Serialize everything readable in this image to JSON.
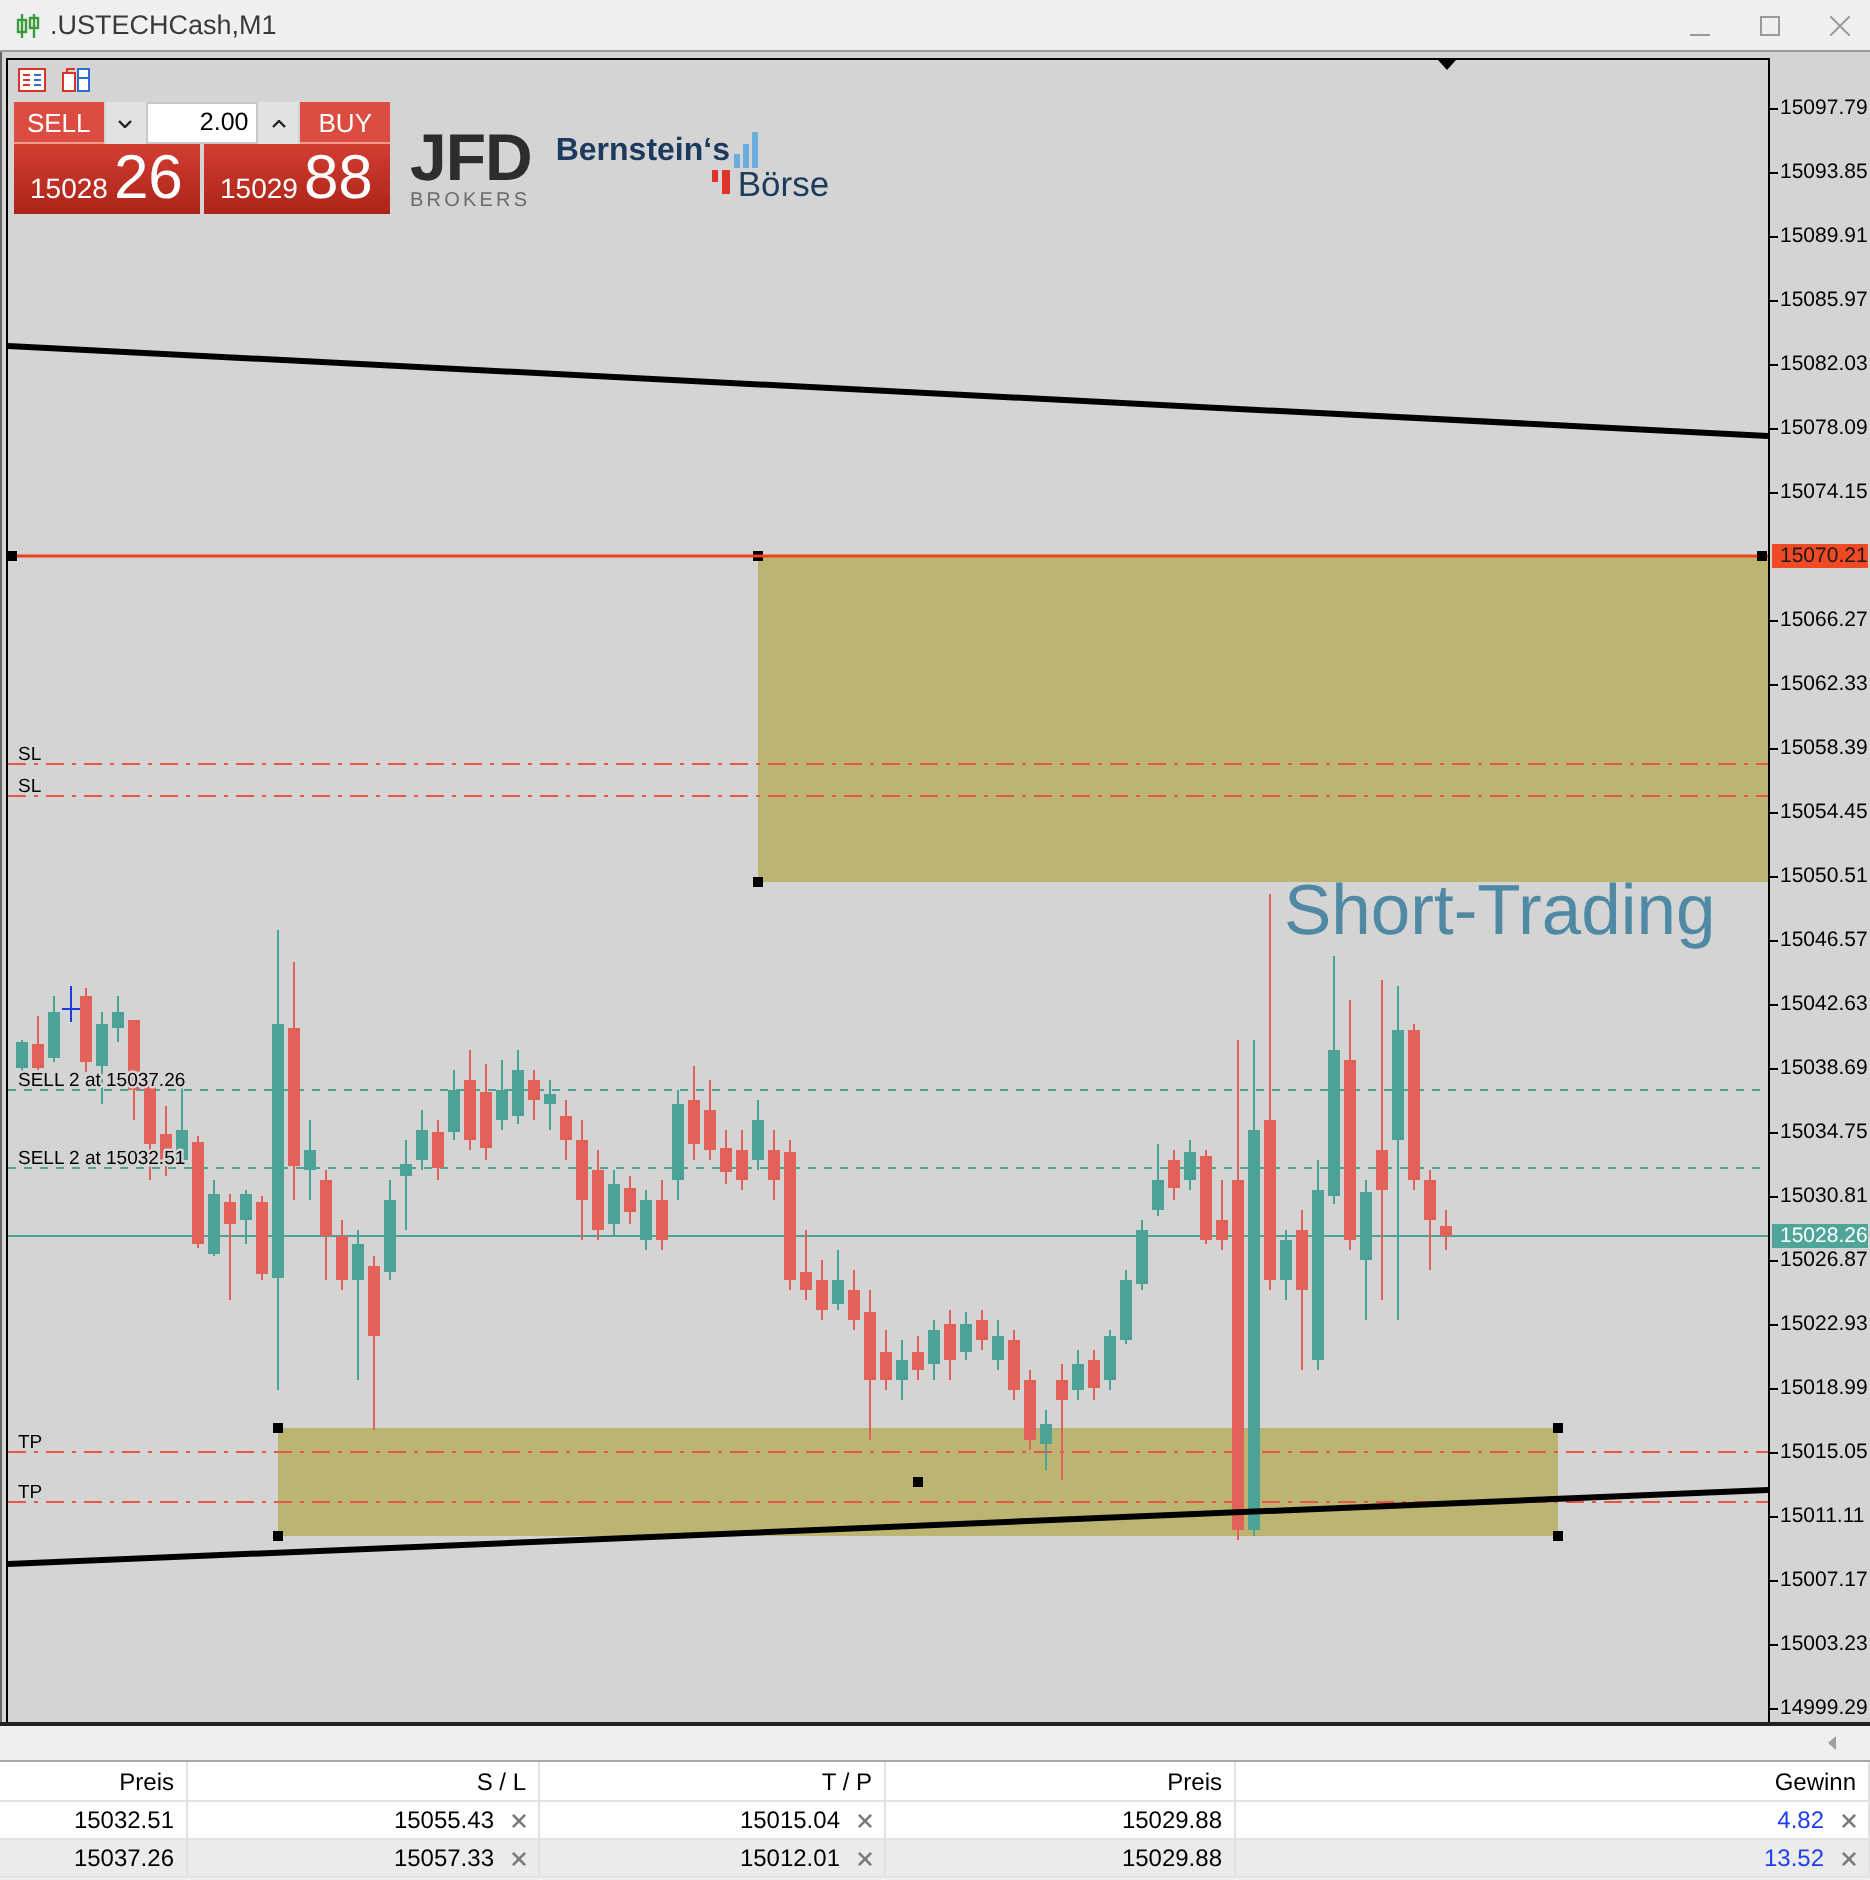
{
  "window": {
    "title": ".USTECHCash,M1"
  },
  "trade_panel": {
    "sell": {
      "label": "SELL",
      "price_lead": "15028",
      "price_pips": "26"
    },
    "buy": {
      "label": "BUY",
      "price_lead": "15029",
      "price_pips": "88"
    },
    "lot": {
      "value": "2.00"
    }
  },
  "logos": {
    "jfd": {
      "wordmark": "JFD",
      "tagline": "BROKERS"
    },
    "bernstein": {
      "line_1": "Bernstein‘s",
      "line_2": "Börse"
    }
  },
  "chart": {
    "caption": "Short-Trading",
    "order_lines": [
      {
        "kind": "sl",
        "label": "SL"
      },
      {
        "kind": "sl",
        "label": "SL"
      },
      {
        "kind": "entry",
        "label": "SELL 2 at 15037.26"
      },
      {
        "kind": "entry",
        "label": "SELL 2 at 15032.51"
      },
      {
        "kind": "tp",
        "label": "TP"
      },
      {
        "kind": "tp",
        "label": "TP"
      }
    ],
    "price_axis": [
      "15097.79",
      "15093.85",
      "15089.91",
      "15085.97",
      "15082.03",
      "15078.09",
      "15074.15",
      "15066.27",
      "15062.33",
      "15058.39",
      "15054.45",
      "15050.51",
      "15046.57",
      "15042.63",
      "15038.69",
      "15034.75",
      "15030.81",
      "15026.87",
      "15022.93",
      "15018.99",
      "15015.05",
      "15011.11",
      "15007.17",
      "15003.23",
      "14999.29"
    ],
    "price_tags": [
      {
        "kind": "line",
        "text": "15070.21",
        "color": "#f04a24"
      },
      {
        "kind": "bid",
        "text": "15028.26",
        "color": "#4fa597"
      }
    ]
  },
  "trades": {
    "columns": [
      "Preis",
      "S / L",
      "T / P",
      "Preis",
      "Gewinn"
    ],
    "rows": [
      {
        "cells": [
          "15032.51",
          "15055.43",
          "15015.04",
          "15029.88",
          "4.82"
        ]
      },
      {
        "cells": [
          "15037.26",
          "15057.33",
          "15012.01",
          "15029.88",
          "13.52"
        ]
      }
    ]
  }
}
